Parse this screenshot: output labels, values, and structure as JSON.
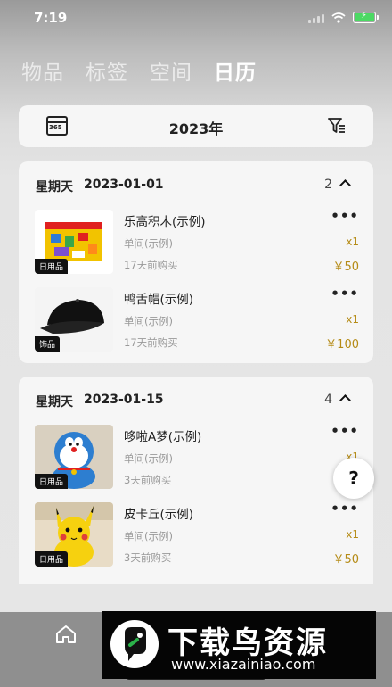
{
  "status": {
    "time": "7:19"
  },
  "tabs": [
    {
      "label": "物品",
      "active": false
    },
    {
      "label": "标签",
      "active": false
    },
    {
      "label": "空间",
      "active": false
    },
    {
      "label": "日历",
      "active": true
    }
  ],
  "year_bar": {
    "calendar_badge": "365",
    "year": "2023年"
  },
  "days": [
    {
      "weekday": "星期天",
      "date": "2023-01-01",
      "count": "2",
      "items": [
        {
          "name": "乐高积木(示例)",
          "tag": "日用品",
          "room": "单间(示例)",
          "ago": "17天前购买",
          "qty": "x1",
          "price": "￥50",
          "thumb_icon": "lego-box-image"
        },
        {
          "name": "鸭舌帽(示例)",
          "tag": "饰品",
          "room": "单间(示例)",
          "ago": "17天前购买",
          "qty": "x1",
          "price": "￥100",
          "thumb_icon": "black-cap-image"
        }
      ]
    },
    {
      "weekday": "星期天",
      "date": "2023-01-15",
      "count": "4",
      "items": [
        {
          "name": "哆啦A梦(示例)",
          "tag": "日用品",
          "room": "单间(示例)",
          "ago": "3天前购买",
          "qty": "x1",
          "price": "",
          "thumb_icon": "doraemon-plush-image"
        },
        {
          "name": "皮卡丘(示例)",
          "tag": "日用品",
          "room": "单间(示例)",
          "ago": "3天前购买",
          "qty": "x1",
          "price": "￥50",
          "thumb_icon": "pikachu-plush-image"
        }
      ]
    }
  ],
  "more_label": "•••",
  "help_label": "?",
  "watermark": {
    "title": "下载鸟资源",
    "url": "www.xiazainiao.com"
  },
  "colors": {
    "accent": "#b58b16",
    "card": "#f6f6f6",
    "bottom_bar": "#8f8f8f"
  }
}
